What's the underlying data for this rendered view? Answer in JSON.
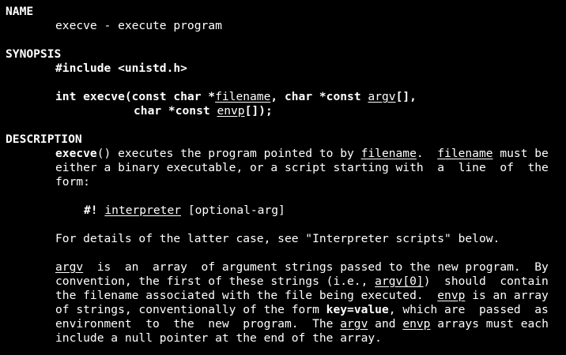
{
  "sections": {
    "name": {
      "heading": "NAME",
      "text": "execve - execute program"
    },
    "synopsis": {
      "heading": "SYNOPSIS",
      "include": "#include <unistd.h>",
      "sig1": {
        "a": "int execve(const char *",
        "filename": "filename",
        "b": ", char *const ",
        "argv": "argv",
        "c": "[],"
      },
      "sig2": {
        "a": "char *const ",
        "envp": "envp",
        "b": "[]);"
      }
    },
    "description": {
      "heading": "DESCRIPTION",
      "p1": {
        "l1": {
          "func": "execve",
          "a": "() executes the program pointed to by ",
          "fn1": "filename",
          "b": ".  ",
          "fn2": "filename",
          "c": " must be"
        },
        "l2": "either a binary executable, or a script starting with  a  line  of  the",
        "l3": "form:"
      },
      "shebang": {
        "prefix": "#!",
        "interp": "interpreter",
        "rest": " [optional-arg]"
      },
      "p2": "For details of the latter case, see \"Interpreter scripts\" below.",
      "p3": {
        "l1": {
          "argv": "argv",
          "a": "  is  an  array  of argument strings passed to the new program.  By"
        },
        "l2": {
          "a": "convention, the first of these strings (i.e., ",
          "argv0": "argv[0]",
          "b": ")  should  contain"
        },
        "l3": {
          "a": "the filename associated with the file being executed.  ",
          "envp": "envp",
          "b": " is an array"
        },
        "l4": {
          "a": "of strings, conventionally of the form ",
          "kv": "key=value",
          "b": ", which are  passed  as"
        },
        "l5": {
          "a": "environment  to  the  new  program.  The ",
          "argv": "argv",
          "b": " and ",
          "envp": "envp",
          "c": " arrays must each"
        },
        "l6": "include a null pointer at the end of the array."
      }
    }
  }
}
